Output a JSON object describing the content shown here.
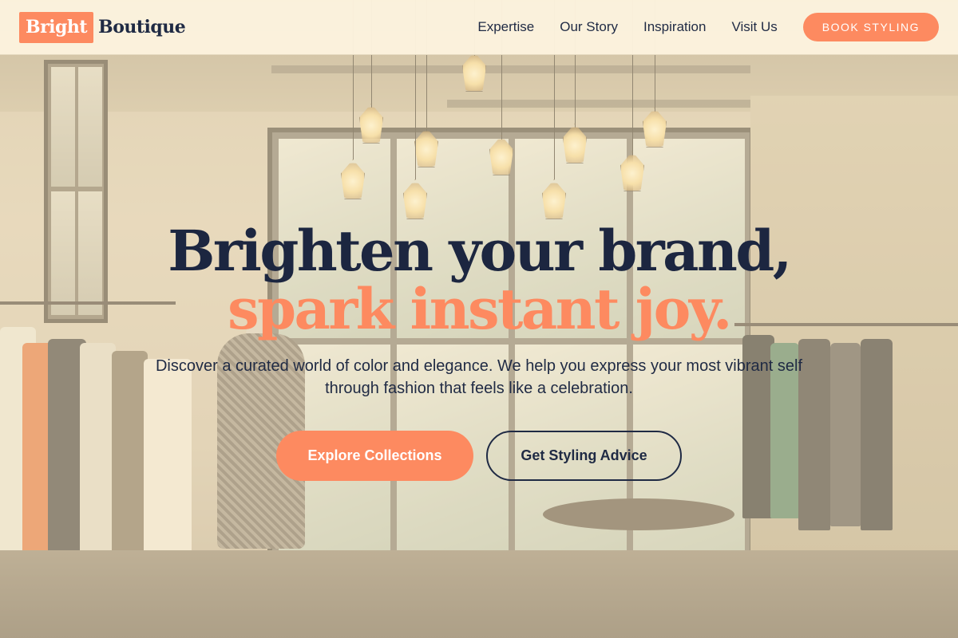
{
  "brand": {
    "mark": "Bright",
    "word": "Boutique",
    "accent_color": "#fd8a60",
    "ink_color": "#1f2a44"
  },
  "nav": {
    "items": [
      {
        "label": "Expertise"
      },
      {
        "label": "Our Story"
      },
      {
        "label": "Inspiration"
      },
      {
        "label": "Visit Us"
      }
    ],
    "cta_label": "BOOK STYLING"
  },
  "hero": {
    "headline_line1": "Brighten your brand,",
    "headline_line2": "spark instant joy.",
    "subtext": "Discover a curated world of color and elegance. We help you express your most vibrant self through fashion that feels like a celebration.",
    "primary_button": "Explore Collections",
    "secondary_button": "Get Styling Advice",
    "background_image": "boutique-interior-photo"
  }
}
